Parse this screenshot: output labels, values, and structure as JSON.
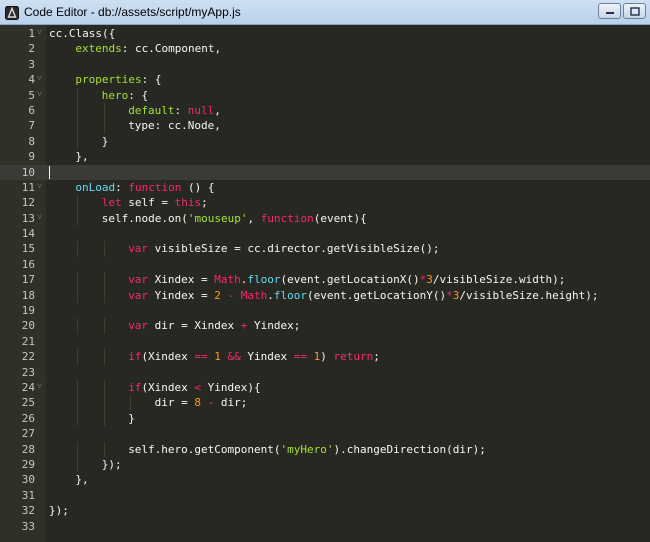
{
  "window": {
    "title": "Code Editor - db://assets/script/myApp.js",
    "buttons": [
      "minimize",
      "maximize"
    ]
  },
  "colors": {
    "editor_bg": "#272822",
    "keyword": "#f92672",
    "function": "#66d9ef",
    "property": "#a6e22e",
    "number": "#fd971f",
    "text": "#f8f8f2"
  },
  "editor": {
    "active_line": 10,
    "lines": [
      {
        "n": "1",
        "fold": "true",
        "indent": 0,
        "tokens": [
          [
            "b",
            "cc.Class({"
          ]
        ]
      },
      {
        "n": "2",
        "fold": "false",
        "indent": 1,
        "tokens": [
          [
            "prop",
            "extends"
          ],
          [
            "b",
            ": cc.Component,"
          ]
        ]
      },
      {
        "n": "3",
        "fold": "false",
        "indent": 0,
        "tokens": []
      },
      {
        "n": "4",
        "fold": "true",
        "indent": 1,
        "tokens": [
          [
            "prop",
            "properties"
          ],
          [
            "b",
            ": {"
          ]
        ]
      },
      {
        "n": "5",
        "fold": "true",
        "indent": 2,
        "tokens": [
          [
            "prop",
            "hero"
          ],
          [
            "b",
            ": {"
          ]
        ]
      },
      {
        "n": "6",
        "fold": "false",
        "indent": 3,
        "tokens": [
          [
            "prop",
            "default"
          ],
          [
            "b",
            ": "
          ],
          [
            "kw",
            "null"
          ],
          [
            "b",
            ","
          ]
        ]
      },
      {
        "n": "7",
        "fold": "false",
        "indent": 3,
        "tokens": [
          [
            "b",
            "type: cc.Node,"
          ]
        ]
      },
      {
        "n": "8",
        "fold": "false",
        "indent": 2,
        "tokens": [
          [
            "b",
            "}"
          ]
        ]
      },
      {
        "n": "9",
        "fold": "false",
        "indent": 1,
        "tokens": [
          [
            "b",
            "},"
          ]
        ]
      },
      {
        "n": "10",
        "fold": "false",
        "indent": 0,
        "tokens": []
      },
      {
        "n": "11",
        "fold": "true",
        "indent": 1,
        "tokens": [
          [
            "fn",
            "onLoad"
          ],
          [
            "b",
            ": "
          ],
          [
            "kw",
            "function"
          ],
          [
            "b",
            " () {"
          ]
        ]
      },
      {
        "n": "12",
        "fold": "false",
        "indent": 2,
        "tokens": [
          [
            "kw",
            "let"
          ],
          [
            "b",
            " self = "
          ],
          [
            "kw",
            "this"
          ],
          [
            "b",
            ";"
          ]
        ]
      },
      {
        "n": "13",
        "fold": "true",
        "indent": 2,
        "tokens": [
          [
            "b",
            "self.node.on("
          ],
          [
            "str",
            "'mouseup'"
          ],
          [
            "b",
            ", "
          ],
          [
            "kw",
            "function"
          ],
          [
            "b",
            "(event){"
          ]
        ]
      },
      {
        "n": "14",
        "fold": "false",
        "indent": 0,
        "tokens": []
      },
      {
        "n": "15",
        "fold": "false",
        "indent": 3,
        "tokens": [
          [
            "kw",
            "var"
          ],
          [
            "b",
            " visibleSize = cc.director.getVisibleSize();"
          ]
        ]
      },
      {
        "n": "16",
        "fold": "false",
        "indent": 0,
        "tokens": []
      },
      {
        "n": "17",
        "fold": "false",
        "indent": 3,
        "tokens": [
          [
            "kw",
            "var"
          ],
          [
            "b",
            " Xindex = "
          ],
          [
            "kw",
            "Math"
          ],
          [
            "b",
            "."
          ],
          [
            "fn",
            "floor"
          ],
          [
            "b",
            "(event.getLocationX()"
          ],
          [
            "op",
            "*"
          ],
          [
            "num",
            "3"
          ],
          [
            "b",
            "/visibleSize.width);"
          ]
        ]
      },
      {
        "n": "18",
        "fold": "false",
        "indent": 3,
        "tokens": [
          [
            "kw",
            "var"
          ],
          [
            "b",
            " Yindex = "
          ],
          [
            "num",
            "2"
          ],
          [
            "b",
            " "
          ],
          [
            "op",
            "-"
          ],
          [
            "b",
            " "
          ],
          [
            "kw",
            "Math"
          ],
          [
            "b",
            "."
          ],
          [
            "fn",
            "floor"
          ],
          [
            "b",
            "(event.getLocationY()"
          ],
          [
            "op",
            "*"
          ],
          [
            "num",
            "3"
          ],
          [
            "b",
            "/visibleSize.height);"
          ]
        ]
      },
      {
        "n": "19",
        "fold": "false",
        "indent": 0,
        "tokens": []
      },
      {
        "n": "20",
        "fold": "false",
        "indent": 3,
        "tokens": [
          [
            "kw",
            "var"
          ],
          [
            "b",
            " dir = Xindex "
          ],
          [
            "op",
            "+"
          ],
          [
            "b",
            " Yindex;"
          ]
        ]
      },
      {
        "n": "21",
        "fold": "false",
        "indent": 0,
        "tokens": []
      },
      {
        "n": "22",
        "fold": "false",
        "indent": 3,
        "tokens": [
          [
            "kw",
            "if"
          ],
          [
            "b",
            "(Xindex "
          ],
          [
            "op",
            "=="
          ],
          [
            "b",
            " "
          ],
          [
            "num",
            "1"
          ],
          [
            "b",
            " "
          ],
          [
            "op",
            "&&"
          ],
          [
            "b",
            " Yindex "
          ],
          [
            "op",
            "=="
          ],
          [
            "b",
            " "
          ],
          [
            "num",
            "1"
          ],
          [
            "b",
            ") "
          ],
          [
            "kw",
            "return"
          ],
          [
            "b",
            ";"
          ]
        ]
      },
      {
        "n": "23",
        "fold": "false",
        "indent": 0,
        "tokens": []
      },
      {
        "n": "24",
        "fold": "true",
        "indent": 3,
        "tokens": [
          [
            "kw",
            "if"
          ],
          [
            "b",
            "(Xindex "
          ],
          [
            "op",
            "<"
          ],
          [
            "b",
            " Yindex){"
          ]
        ]
      },
      {
        "n": "25",
        "fold": "false",
        "indent": 4,
        "tokens": [
          [
            "b",
            "dir = "
          ],
          [
            "num",
            "8"
          ],
          [
            "b",
            " "
          ],
          [
            "op",
            "-"
          ],
          [
            "b",
            " dir;"
          ]
        ]
      },
      {
        "n": "26",
        "fold": "false",
        "indent": 3,
        "tokens": [
          [
            "b",
            "}"
          ]
        ]
      },
      {
        "n": "27",
        "fold": "false",
        "indent": 0,
        "tokens": []
      },
      {
        "n": "28",
        "fold": "false",
        "indent": 3,
        "tokens": [
          [
            "b",
            "self.hero.getComponent("
          ],
          [
            "str",
            "'myHero'"
          ],
          [
            "b",
            ").changeDirection(dir);"
          ]
        ]
      },
      {
        "n": "29",
        "fold": "false",
        "indent": 2,
        "tokens": [
          [
            "b",
            "});"
          ]
        ]
      },
      {
        "n": "30",
        "fold": "false",
        "indent": 1,
        "tokens": [
          [
            "b",
            "},"
          ]
        ]
      },
      {
        "n": "31",
        "fold": "false",
        "indent": 0,
        "tokens": []
      },
      {
        "n": "32",
        "fold": "false",
        "indent": 0,
        "tokens": [
          [
            "b",
            "});"
          ]
        ]
      },
      {
        "n": "33",
        "fold": "false",
        "indent": 0,
        "tokens": []
      }
    ]
  }
}
